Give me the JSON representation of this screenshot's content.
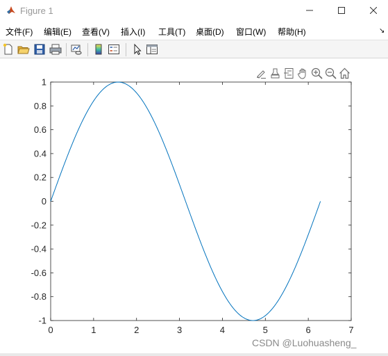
{
  "window": {
    "title": "Figure 1",
    "icon": "matlab-logo-icon"
  },
  "menu": {
    "items": [
      {
        "id": "file",
        "label": "文件(F)"
      },
      {
        "id": "edit",
        "label": "编辑(E)"
      },
      {
        "id": "view",
        "label": "查看(V)"
      },
      {
        "id": "insert",
        "label": "插入(I)"
      },
      {
        "id": "tools",
        "label": "工具(T)"
      },
      {
        "id": "desktop",
        "label": "桌面(D)"
      },
      {
        "id": "window",
        "label": "窗口(W)"
      },
      {
        "id": "help",
        "label": "帮助(H)"
      }
    ],
    "overflow_icon": "chevron-icon"
  },
  "toolbar": {
    "buttons": [
      "new-figure-icon",
      "open-file-icon",
      "save-icon",
      "print-icon",
      "link-plot-icon",
      "colorbar-icon",
      "legend-icon",
      "edit-plot-icon",
      "property-inspector-icon"
    ]
  },
  "axes_toolbar": {
    "buttons": [
      "brush-icon",
      "data-tips-icon",
      "export-icon",
      "pan-icon",
      "zoom-in-icon",
      "zoom-out-icon",
      "home-icon"
    ]
  },
  "colors": {
    "line": "#0072BD",
    "axes": "#262626"
  },
  "chart_data": {
    "type": "line",
    "function": "sin(x)",
    "x_range": [
      0,
      6.2832
    ],
    "series": [
      {
        "x": [
          0,
          0.3927,
          0.7854,
          1.1781,
          1.5708,
          1.9635,
          2.3562,
          2.7489,
          3.1416,
          3.5343,
          3.927,
          4.3197,
          4.7124,
          5.1051,
          5.4978,
          5.8905,
          6.2832
        ],
        "y": [
          0,
          0.3827,
          0.7071,
          0.9239,
          1,
          0.9239,
          0.7071,
          0.3827,
          0,
          -0.3827,
          -0.7071,
          -0.9239,
          -1,
          -0.9239,
          -0.7071,
          -0.3827,
          0
        ]
      }
    ],
    "xlim": [
      0,
      7
    ],
    "ylim": [
      -1,
      1
    ],
    "xticks": [
      "0",
      "1",
      "2",
      "3",
      "4",
      "5",
      "6",
      "7"
    ],
    "yticks": [
      "-1",
      "-0.8",
      "-0.6",
      "-0.4",
      "-0.2",
      "0",
      "0.2",
      "0.4",
      "0.6",
      "0.8",
      "1"
    ],
    "grid": false,
    "title": "",
    "xlabel": "",
    "ylabel": ""
  },
  "watermark": "CSDN @Luohuasheng_"
}
